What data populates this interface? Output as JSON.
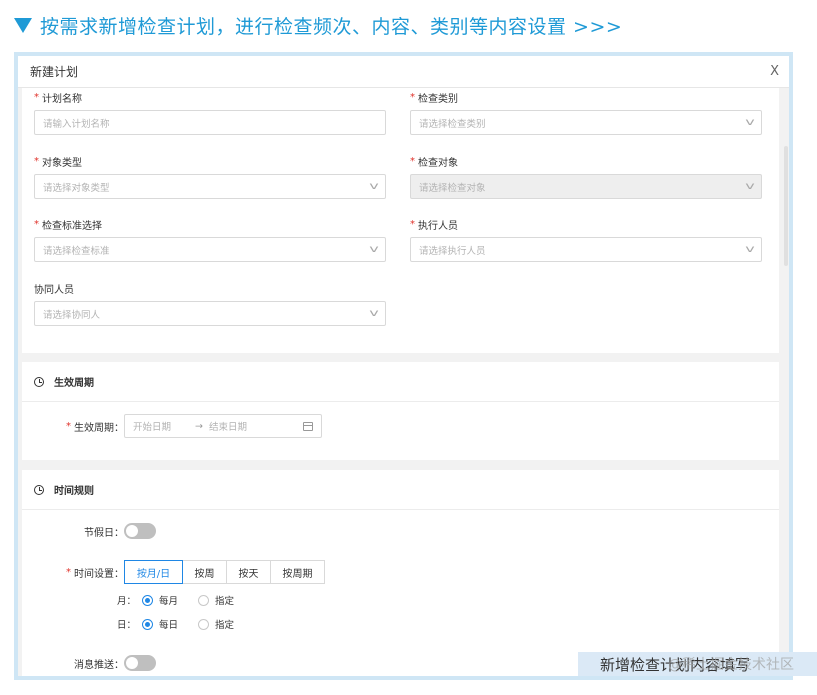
{
  "banner": {
    "text": "按需求新增检查计划，进行检查频次、内容、类别等内容设置 >>>"
  },
  "dialog": {
    "title": "新建计划",
    "close": "X"
  },
  "form": {
    "plan_name": {
      "label": "计划名称",
      "placeholder": "请输入计划名称"
    },
    "check_category": {
      "label": "检查类别",
      "placeholder": "请选择检查类别"
    },
    "object_type": {
      "label": "对象类型",
      "placeholder": "请选择对象类型"
    },
    "check_object": {
      "label": "检查对象",
      "placeholder": "请选择检查对象"
    },
    "check_standard": {
      "label": "检查标准选择",
      "placeholder": "请选择检查标准"
    },
    "executor": {
      "label": "执行人员",
      "placeholder": "请选择执行人员"
    },
    "assistant": {
      "label": "协同人员",
      "placeholder": "请选择协同人"
    }
  },
  "period": {
    "section_title": "生效周期",
    "label": "生效周期：",
    "start_placeholder": "开始日期",
    "separator": "→",
    "end_placeholder": "结束日期"
  },
  "rules": {
    "section_title": "时间规则",
    "holiday_label": "节假日：",
    "time_setting_label": "时间设置：",
    "time_tabs": [
      "按月/日",
      "按周",
      "按天",
      "按周期"
    ],
    "month_label": "月：",
    "day_label": "日：",
    "every_month": "每月",
    "every_day": "每日",
    "specify": "指定",
    "push_label": "消息推送："
  },
  "caption": {
    "text": "新增检查计划内容填写"
  },
  "watermark": {
    "text": "@稀土掘金技术社区"
  },
  "colors": {
    "accent": "#1f87e5",
    "banner": "#1f9ad6",
    "required": "#e0322b"
  }
}
